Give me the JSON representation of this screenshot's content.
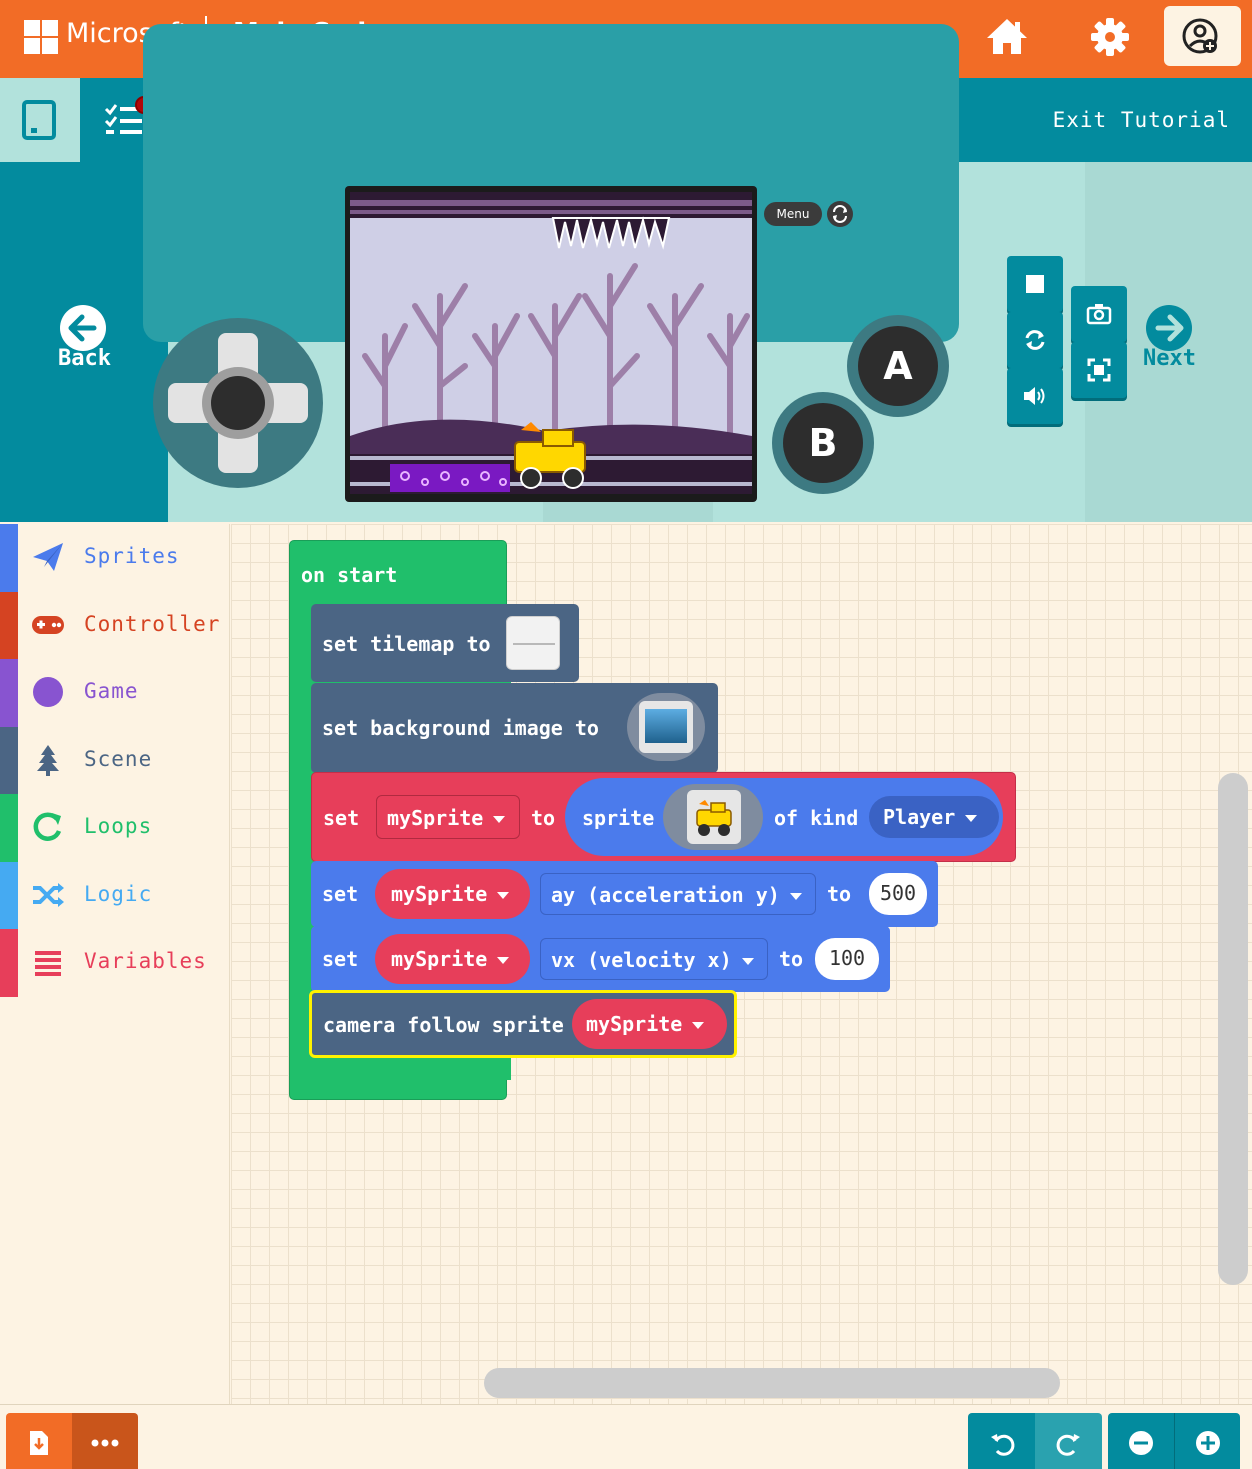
{
  "header": {
    "brand": "Microsoft",
    "product": "MakeCode"
  },
  "tutorial": {
    "exit_label": "Exit Tutorial"
  },
  "simulator": {
    "menu_label": "Menu",
    "button_a": "A",
    "button_b": "B",
    "back_label": "Back",
    "next_label": "Next"
  },
  "toolbox": {
    "categories": [
      {
        "label": "Sprites",
        "color": "#4b7bec"
      },
      {
        "label": "Controller",
        "color": "#d54322"
      },
      {
        "label": "Game",
        "color": "#8854d0"
      },
      {
        "label": "Scene",
        "color": "#4b6584"
      },
      {
        "label": "Loops",
        "color": "#20bf6b"
      },
      {
        "label": "Logic",
        "color": "#45aaf2"
      },
      {
        "label": "Variables",
        "color": "#e73e5a"
      }
    ]
  },
  "blocks": {
    "on_start": "on start",
    "set_tilemap": "set tilemap to",
    "set_background": "set background image to",
    "set": "set",
    "to": "to",
    "sprite": "sprite",
    "of_kind": "of kind",
    "kind_value": "Player",
    "var_name": "mySprite",
    "prop_ay": "ay (acceleration y)",
    "val_ay": "500",
    "prop_vx": "vx (velocity x)",
    "val_vx": "100",
    "camera_follow": "camera follow sprite"
  },
  "colors": {
    "header": "#f26c26",
    "tutorial_bar": "#038b9e",
    "loops_green": "#20bf6b",
    "scene_slate": "#4b6584",
    "variables_red": "#e73e5a",
    "sprites_blue": "#4b7bec",
    "highlight_yellow": "#fff200"
  }
}
